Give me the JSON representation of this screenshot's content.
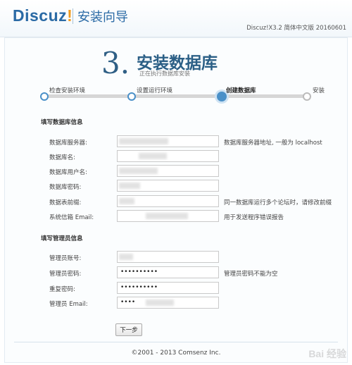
{
  "header": {
    "logo_text": "Discuz",
    "logo_excl": "!",
    "title": "安装向导",
    "version": "Discuz!X3.2 简体中文版 20160601"
  },
  "step": {
    "number": "3.",
    "title": "安装数据库",
    "subtitle": "正在执行数据库安装"
  },
  "progress": {
    "steps": [
      {
        "label": "检查安装环境",
        "state": "done"
      },
      {
        "label": "设置运行环境",
        "state": "done"
      },
      {
        "label": "创建数据库",
        "state": "active"
      },
      {
        "label": "安装",
        "state": "pending"
      }
    ]
  },
  "db_section": {
    "title": "填写数据库信息",
    "fields": [
      {
        "label": "数据库服务器:",
        "value": "",
        "hint": "数据库服务器地址, 一般为 localhost"
      },
      {
        "label": "数据库名:",
        "value": "",
        "hint": ""
      },
      {
        "label": "数据库用户名:",
        "value": "",
        "hint": ""
      },
      {
        "label": "数据库密码:",
        "value": "",
        "hint": ""
      },
      {
        "label": "数据表前缀:",
        "value": "",
        "hint": "同一数据库运行多个论坛时，请修改前缀"
      },
      {
        "label": "系统信箱 Email:",
        "value": "",
        "hint": "用于发送程序错误报告"
      }
    ]
  },
  "admin_section": {
    "title": "填写管理员信息",
    "fields": [
      {
        "label": "管理员账号:",
        "value": "",
        "hint": ""
      },
      {
        "label": "管理员密码:",
        "value": "••••••••••",
        "hint": "管理员密码不能为空"
      },
      {
        "label": "重复密码:",
        "value": "••••••••••",
        "hint": ""
      },
      {
        "label": "管理员 Email:",
        "value": "••••",
        "hint": ""
      }
    ]
  },
  "buttons": {
    "next": "下一步"
  },
  "footer": {
    "copyright": "©2001 - 2013 Comsenz Inc."
  },
  "watermark": "Bai 经验"
}
